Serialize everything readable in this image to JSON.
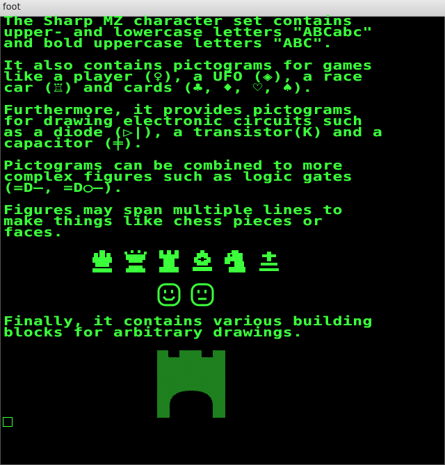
{
  "window": {
    "title": "foot"
  },
  "terminal": {
    "lines": [
      "The Sharp MZ character set contains",
      "upper- and lowercase letters \"ABCabc\"",
      "and bold uppercase letters \"ABC\".",
      "",
      "It also contains pictograms for games",
      "like a player (♀), a UFO (◈), a race",
      "car (♖) and cards (♣, ♦, ♡, ♠).",
      "",
      "Furthermore, it provides pictograms",
      "for drawing electronic circuits such",
      "as a diode (▷|), a transistor(K) and a",
      "capacitor (╪).",
      "",
      "Pictograms can be combined to more",
      "complex figures such as logic gates",
      "(=D—, =D○—).",
      "",
      "Figures may span multiple lines to",
      "make things like chess pieces or",
      "faces.",
      "",
      "",
      "",
      "",
      "",
      "",
      "",
      "Finally, it contains various building",
      "blocks for arbitrary drawings."
    ],
    "chess_pieces": [
      "king-icon",
      "queen-icon",
      "rook-icon",
      "bishop-icon",
      "knight-icon",
      "pawn-icon"
    ],
    "faces": [
      "smiling-face-icon",
      "neutral-face-icon"
    ],
    "color": "#3bff3b"
  }
}
